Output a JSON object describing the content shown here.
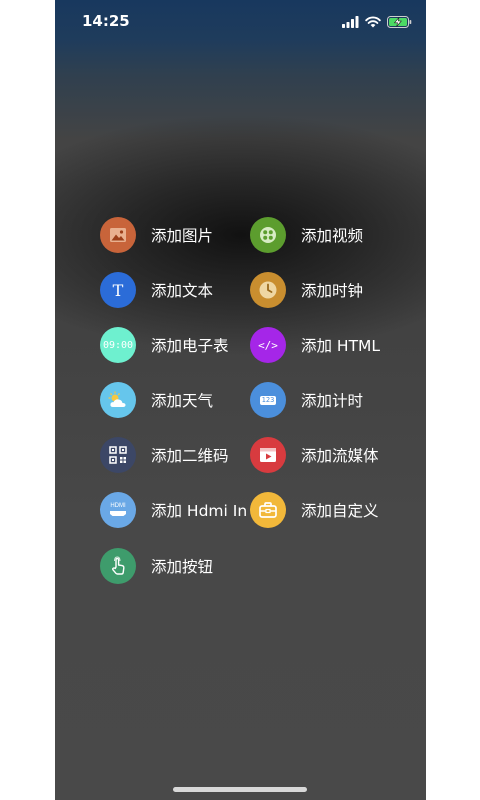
{
  "status_bar": {
    "time": "14:25",
    "icons": [
      "signal-icon",
      "wifi-icon",
      "battery-charging-icon"
    ]
  },
  "menu": {
    "items": [
      {
        "label": "添加图片",
        "icon": "image-icon",
        "color": "#c8643a"
      },
      {
        "label": "添加视频",
        "icon": "video-icon",
        "color": "#5c9d2e"
      },
      {
        "label": "添加文本",
        "icon": "text-icon",
        "color": "#2b6cd8",
        "glyph": "T"
      },
      {
        "label": "添加时钟",
        "icon": "clock-icon",
        "color": "#c98e2f"
      },
      {
        "label": "添加电子表",
        "icon": "digital-clock-icon",
        "color": "#6ef0cf",
        "glyph": "09:00"
      },
      {
        "label": "添加 HTML",
        "icon": "code-icon",
        "color": "#a526e8",
        "glyph": "</>"
      },
      {
        "label": "添加天气",
        "icon": "weather-icon",
        "color": "#66c6ec"
      },
      {
        "label": "添加计时",
        "icon": "timer-icon",
        "color": "#4b8fdc",
        "glyph": "123"
      },
      {
        "label": "添加二维码",
        "icon": "qr-code-icon",
        "color": "#3c4766"
      },
      {
        "label": "添加流媒体",
        "icon": "stream-icon",
        "color": "#d83b3f"
      },
      {
        "label": "添加 Hdmi In",
        "icon": "hdmi-icon",
        "color": "#6aa8e6",
        "glyph": "HDMI"
      },
      {
        "label": "添加自定义",
        "icon": "toolbox-icon",
        "color": "#f2b83a"
      },
      {
        "label": "添加按钮",
        "icon": "touch-icon",
        "color": "#3e9c6c"
      }
    ]
  }
}
